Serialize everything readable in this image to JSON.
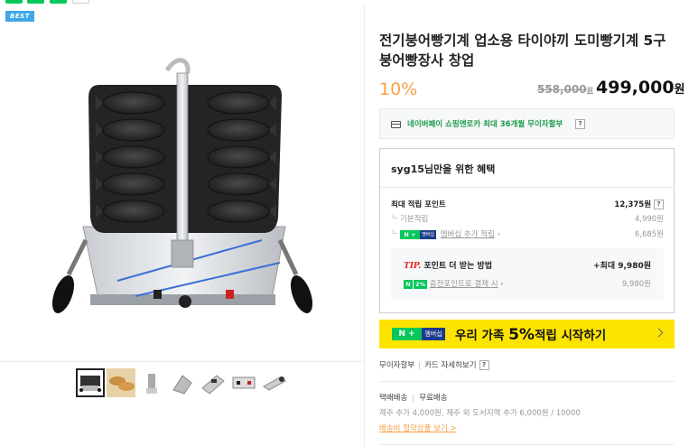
{
  "colors": {
    "accent_orange": "#f6a245",
    "naver_green": "#03c75a",
    "banner_yellow": "#fde400",
    "best_blue": "#3ea8e6"
  },
  "gallery": {
    "badge": "BEST",
    "thumbnail_count": 7
  },
  "product": {
    "title": "전기붕어빵기계 업소용 타이야끼 도미빵기계 5구 붕어빵장사 창업",
    "discount": "10%",
    "original_price": "558,000",
    "original_unit": "원",
    "price": "499,000",
    "price_unit": "원"
  },
  "npay": {
    "text": "네이버페이 쇼핑엔로카 최대 36개월 무이자할부",
    "help": "?"
  },
  "benefit": {
    "heading": "syg15님만을 위한 혜택",
    "max_points_label": "최대 적립 포인트",
    "max_points_value": "12,375원",
    "help": "?",
    "basic_label": "기본적립",
    "basic_value": "4,990원",
    "member_badge_n": "N +",
    "member_badge_text": "멤버십",
    "member_label": "멤버십 추가 적립",
    "member_value": "6,685원",
    "tip_label": "TIP.",
    "tip_text": "포인트 더 받는 방법",
    "tip_value": "+최대 9,980원",
    "charge_badge_n": "N",
    "charge_badge_pct": "2%",
    "charge_label": "충전포인트로 결제 시",
    "charge_value": "9,980원"
  },
  "banner": {
    "badge_n": "N +",
    "badge_text": "멤버십",
    "text_pre": "우리 가족 ",
    "text_big": "5%",
    "text_post": "적립 시작하기"
  },
  "installment": {
    "label1": "무이자할부",
    "label2": "카드 자세히보기",
    "help": "?"
  },
  "shipping": {
    "type": "택배배송",
    "fee": "무료배송",
    "extra": "제주 추가 4,000원, 제주 외 도서지역 추가 6,000원 / 10000",
    "link": "배송비 절약상품 보기 >"
  }
}
